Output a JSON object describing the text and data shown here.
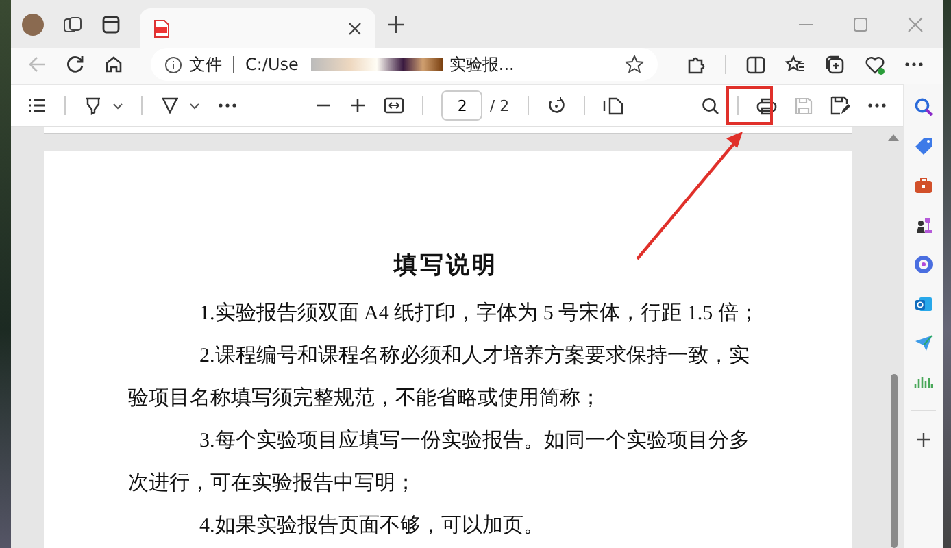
{
  "tabs": [
    {
      "kind": "pdf",
      "selected": true
    }
  ],
  "address_bar": {
    "scheme_label": "文件",
    "url": "C:/Use",
    "title_fragment": "实验报..."
  },
  "pdf_toolbar": {
    "page_number": "2",
    "page_total": "/ 2",
    "print_highlighted": true
  },
  "document": {
    "heading": "填写说明",
    "paragraphs": [
      "1.实验报告须双面 A4 纸打印，字体为 5 号宋体，行距 1.5 倍；",
      "2.课程编号和课程名称必须和人才培养方案要求保持一致，实验项目名称填写须完整规范，不能省略或使用简称；",
      "3.每个实验项目应填写一份实验报告。如同一个实验项目分多次进行，可在实验报告中写明；",
      "4.如果实验报告页面不够，可以加页。"
    ]
  }
}
